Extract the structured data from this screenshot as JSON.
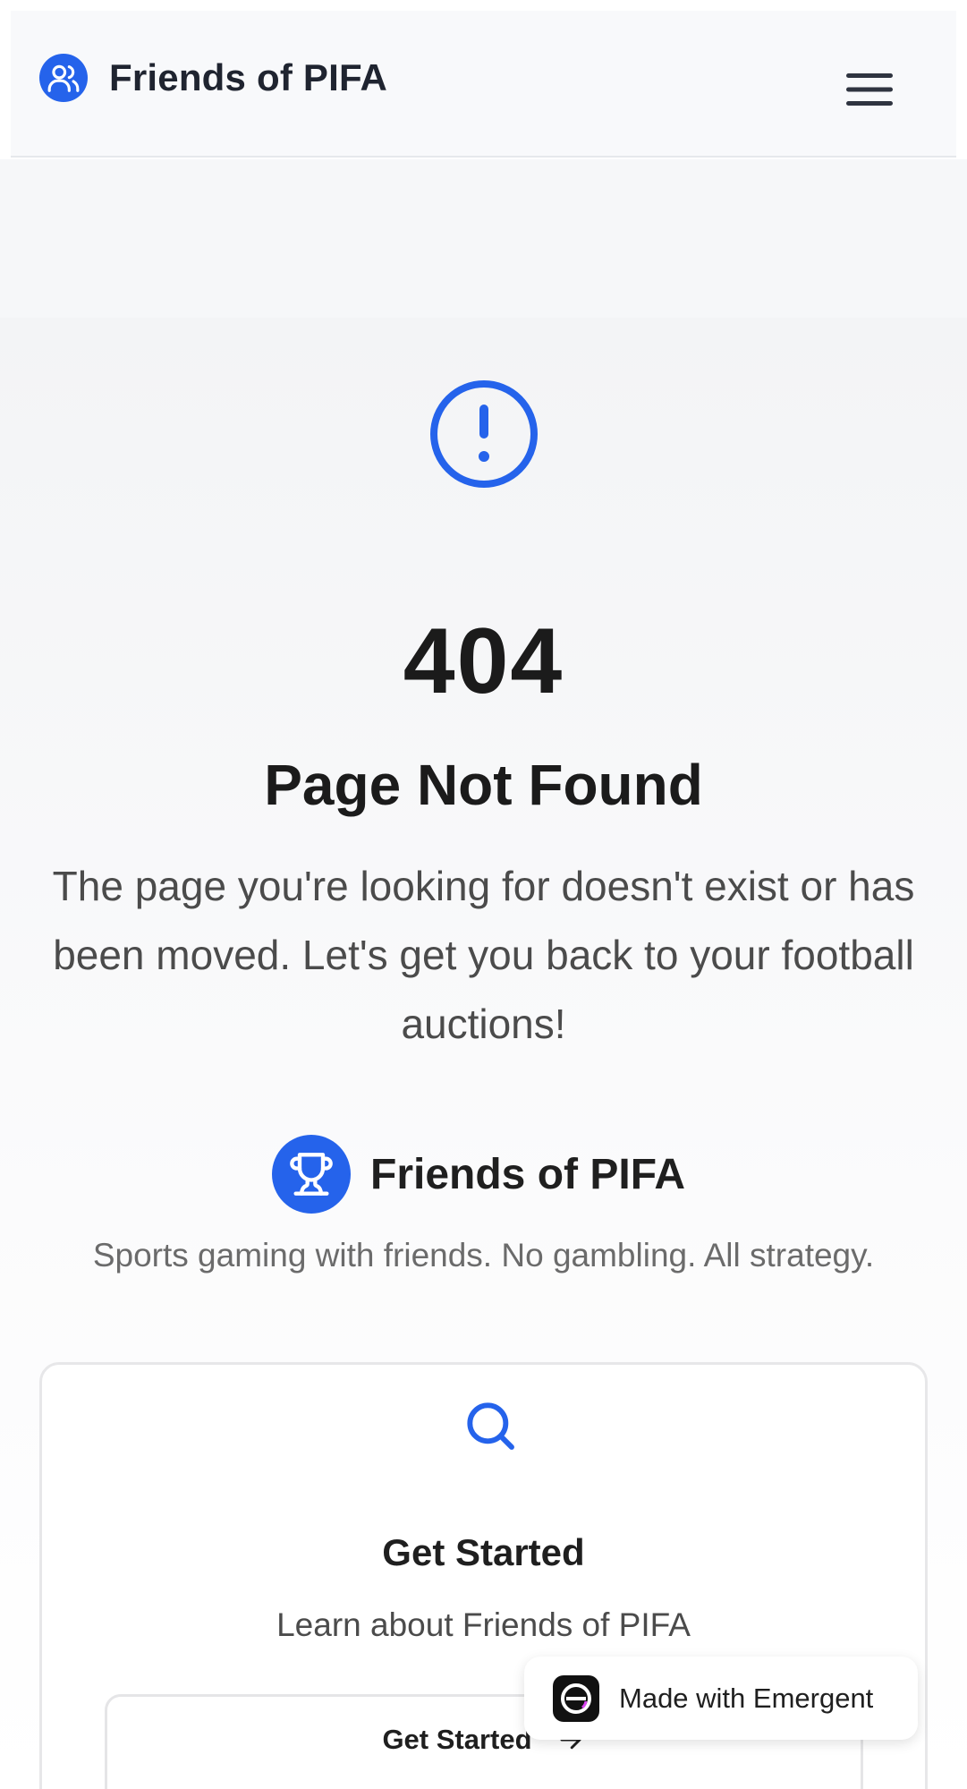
{
  "header": {
    "brand": "Friends of PIFA",
    "logo_icon": "users-icon",
    "menu_icon": "hamburger-menu-icon"
  },
  "main": {
    "alert_icon": "alert-circle-icon",
    "error_code": "404",
    "title": "Page Not Found",
    "description": "The page you're looking for doesn't exist or has been moved. Let's get you back to your football auctions!",
    "brand_name": "Friends of PIFA",
    "brand_icon": "trophy-icon",
    "tagline": "Sports gaming with friends. No gambling. All strategy."
  },
  "card": {
    "icon": "search-icon",
    "title": "Get Started",
    "subtitle": "Learn about Friends of PIFA",
    "button_label": "Get Started",
    "button_icon": "arrow-right-icon"
  },
  "badge": {
    "label": "Made with Emergent",
    "icon": "emergent-logo-icon"
  },
  "colors": {
    "accent": "#2563eb",
    "text": "#1f1f1f",
    "muted": "#6b6b6b"
  }
}
